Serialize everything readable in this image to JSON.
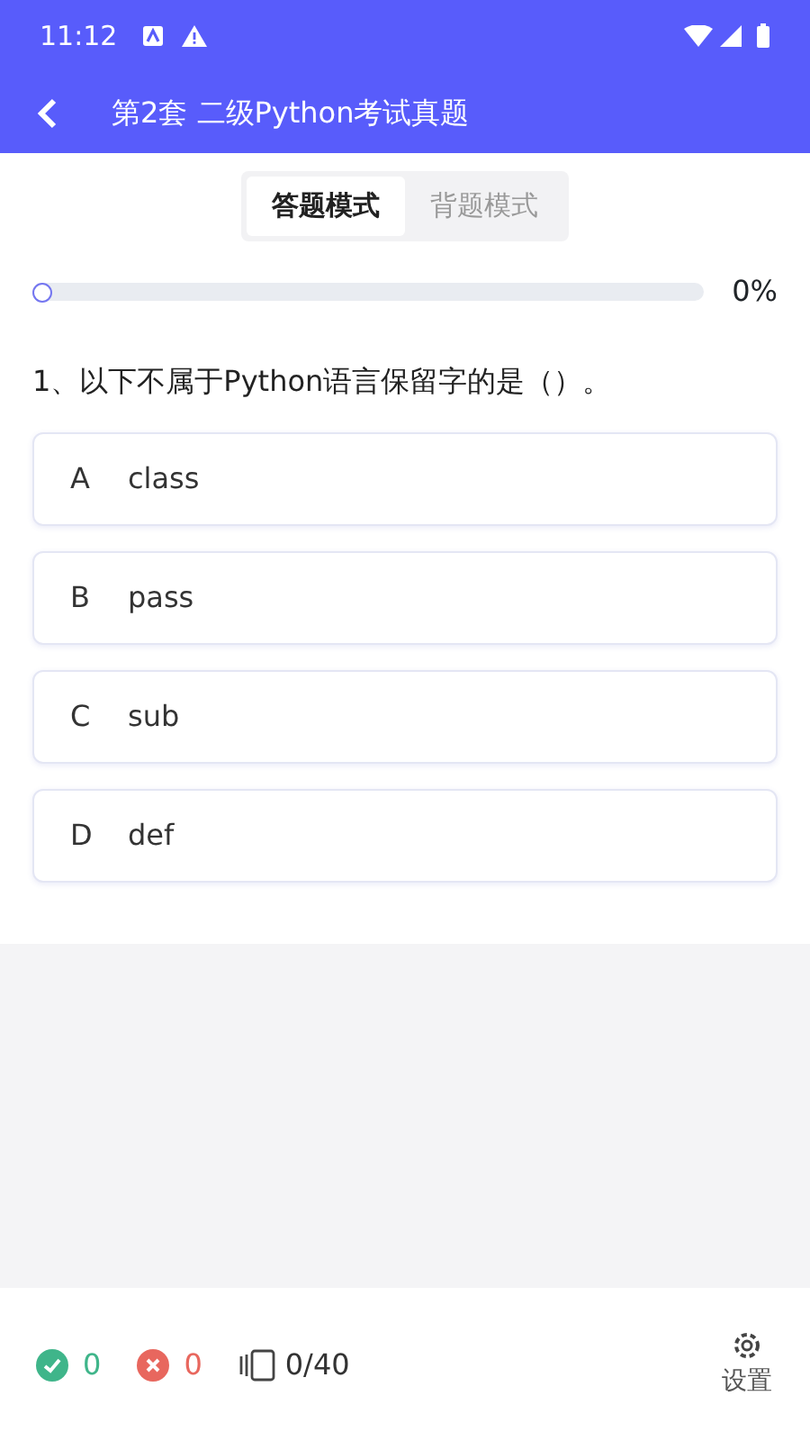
{
  "status_bar": {
    "time": "11:12"
  },
  "header": {
    "title": "第2套 二级Python考试真题"
  },
  "mode_tabs": [
    {
      "label": "答题模式",
      "selected": true
    },
    {
      "label": "背题模式",
      "selected": false
    }
  ],
  "progress": {
    "level": 0,
    "reading": "0%"
  },
  "question": {
    "text": "1、以下不属于Python语言保留字的是（）。"
  },
  "options": [
    {
      "letter": "A",
      "text": "class",
      "selected": false
    },
    {
      "letter": "B",
      "text": "pass",
      "selected": false
    },
    {
      "letter": "C",
      "text": "sub",
      "selected": false
    },
    {
      "letter": "D",
      "text": "def",
      "selected": false
    }
  ],
  "footer": {
    "correct": "0",
    "wrong": "0",
    "count": "0/40",
    "settings": "设置"
  }
}
